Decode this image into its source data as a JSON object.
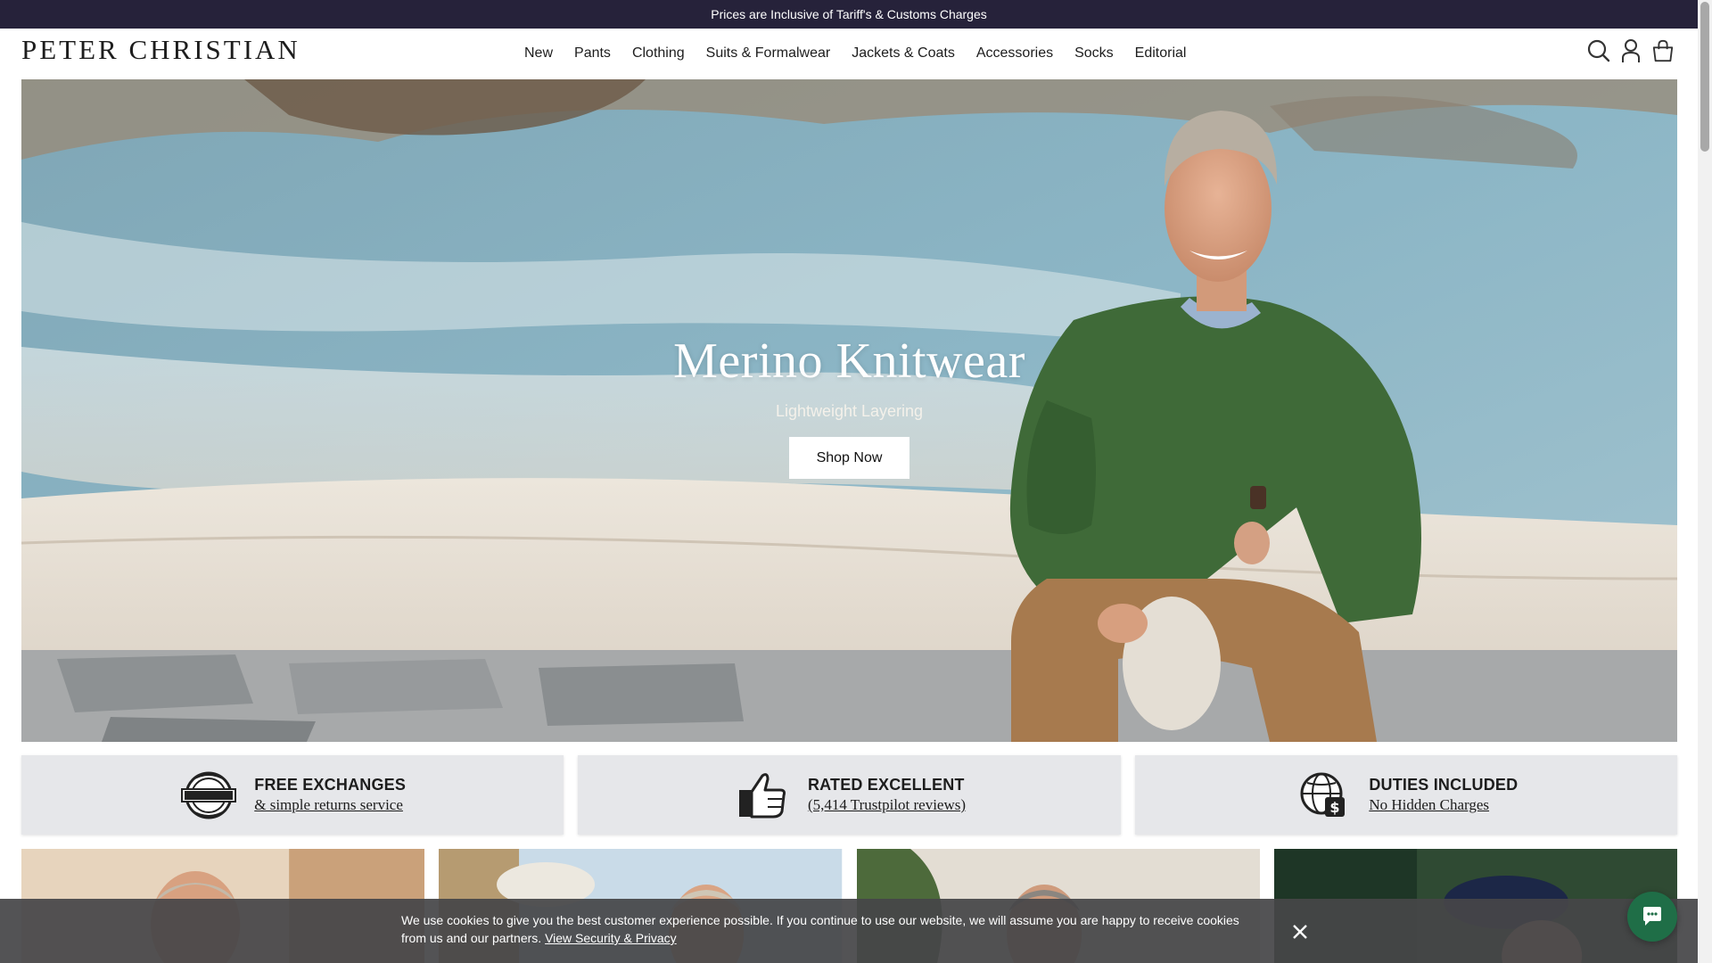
{
  "announcement": {
    "text": "Prices are Inclusive of Tariff's & Customs Charges"
  },
  "brand": {
    "logo_text": "PETER CHRISTIAN"
  },
  "nav": {
    "items": [
      {
        "label": "New"
      },
      {
        "label": "Pants"
      },
      {
        "label": "Clothing"
      },
      {
        "label": "Suits & Formalwear"
      },
      {
        "label": "Jackets & Coats"
      },
      {
        "label": "Accessories"
      },
      {
        "label": "Socks"
      },
      {
        "label": "Editorial"
      }
    ]
  },
  "header_icons": [
    "search-icon",
    "account-icon",
    "bag-icon"
  ],
  "hero": {
    "title": "Merino Knitwear",
    "subtitle": "Lightweight Layering",
    "cta_label": "Shop Now"
  },
  "usps": [
    {
      "icon": "returns-badge-icon",
      "title": "FREE EXCHANGES",
      "link": "& simple returns service"
    },
    {
      "icon": "thumbs-up-icon",
      "title": "RATED EXCELLENT",
      "link": "(5,414 Trustpilot reviews)"
    },
    {
      "icon": "globe-money-icon",
      "title": "DUTIES INCLUDED",
      "link": "No Hidden Charges"
    }
  ],
  "cookie": {
    "text": "We use cookies to give you the best customer experience possible. If you continue to use our website, we will assume you are happy to receive cookies from us and our partners.",
    "link_label": "View Security & Privacy"
  },
  "colors": {
    "announcement_bg": "#26223a",
    "usp_bg": "#e6e7ea",
    "chat_button": "#1f6e47",
    "cookie_bg": "#464648"
  }
}
